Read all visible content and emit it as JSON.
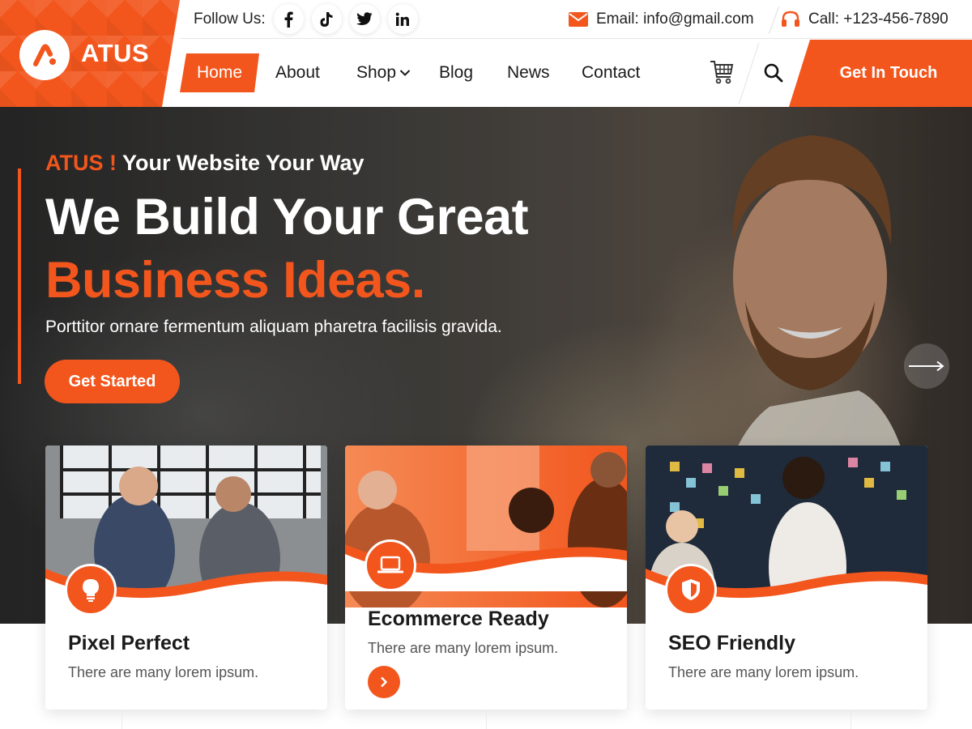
{
  "brand": {
    "name": "ATUS",
    "accent": "#f2561d"
  },
  "topbar": {
    "follow_label": "Follow Us:",
    "socials": [
      "facebook-icon",
      "tiktok-icon",
      "twitter-icon",
      "linkedin-icon"
    ],
    "email": "Email: info@gmail.com",
    "call": "Call: +123-456-7890"
  },
  "nav": {
    "items": [
      "Home",
      "About",
      "Shop",
      "Blog",
      "News",
      "Contact"
    ],
    "active": "Home",
    "cta": "Get In Touch"
  },
  "hero": {
    "tag_accent": "ATUS !",
    "tag_rest": " Your Website Your Way",
    "title_line1": "We Build Your Great",
    "title_line2": "Business Ideas.",
    "subtitle": "Porttitor ornare fermentum aliquam pharetra facilisis gravida.",
    "button": "Get Started"
  },
  "cards": [
    {
      "title": "Pixel Perfect",
      "desc": "There are many lorem ipsum.",
      "icon": "lightbulb-icon"
    },
    {
      "title": "Ecommerce Ready",
      "desc": "There are many lorem ipsum.",
      "icon": "laptop-icon"
    },
    {
      "title": "SEO Friendly",
      "desc": "There are many lorem ipsum.",
      "icon": "shield-icon"
    }
  ]
}
